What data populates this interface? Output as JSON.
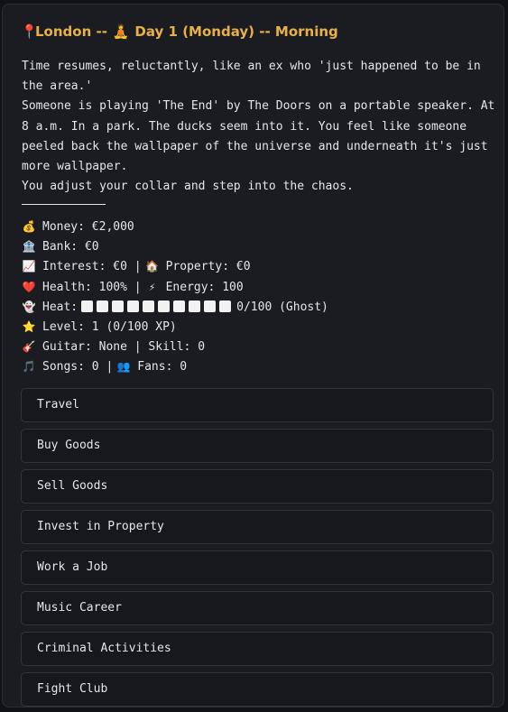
{
  "header": {
    "pin_icon": "📍",
    "location": "London",
    "separator": "--",
    "day_icon": "🧘",
    "day": "Day 1 (Monday)",
    "time_of_day": "Morning"
  },
  "narrative": "Time resumes, reluctantly, like an ex who 'just happened to be in the area.'\nSomeone is playing 'The End' by The Doors on a portable speaker. At 8 a.m. In a park. The ducks seem into it. You feel like someone peeled back the wallpaper of the universe and underneath it's just more wallpaper.\nYou adjust your collar and step into the chaos.",
  "stats": {
    "money": {
      "icon": "💰",
      "label": "Money:",
      "value": "€2,000"
    },
    "bank": {
      "icon": "🏦",
      "label": "Bank:",
      "value": "€0"
    },
    "interest": {
      "icon": "📈",
      "label": "Interest:",
      "value": "€0"
    },
    "property": {
      "icon": "🏠",
      "label": "Property:",
      "value": "€0"
    },
    "health": {
      "icon": "❤️",
      "label": "Health:",
      "value": "100%"
    },
    "energy": {
      "icon": "⚡",
      "label": "Energy:",
      "value": "100"
    },
    "heat": {
      "icon": "👻",
      "label": "Heat:",
      "value": "0/100 (Ghost)",
      "level": 0,
      "max": 100,
      "boxes": 10
    },
    "level": {
      "icon": "⭐",
      "label": "Level:",
      "value": "1 (0/100 XP)"
    },
    "guitar": {
      "icon": "🎸",
      "label": "Guitar:",
      "value": "None"
    },
    "skill": {
      "label": "Skill:",
      "value": "0"
    },
    "songs": {
      "icon": "🎵",
      "label": "Songs:",
      "value": "0"
    },
    "fans": {
      "icon": "👥",
      "label": "Fans:",
      "value": "0"
    },
    "sep": "|"
  },
  "menu": [
    "Travel",
    "Buy Goods",
    "Sell Goods",
    "Invest in Property",
    "Work a Job",
    "Music Career",
    "Criminal Activities",
    "Fight Club"
  ]
}
